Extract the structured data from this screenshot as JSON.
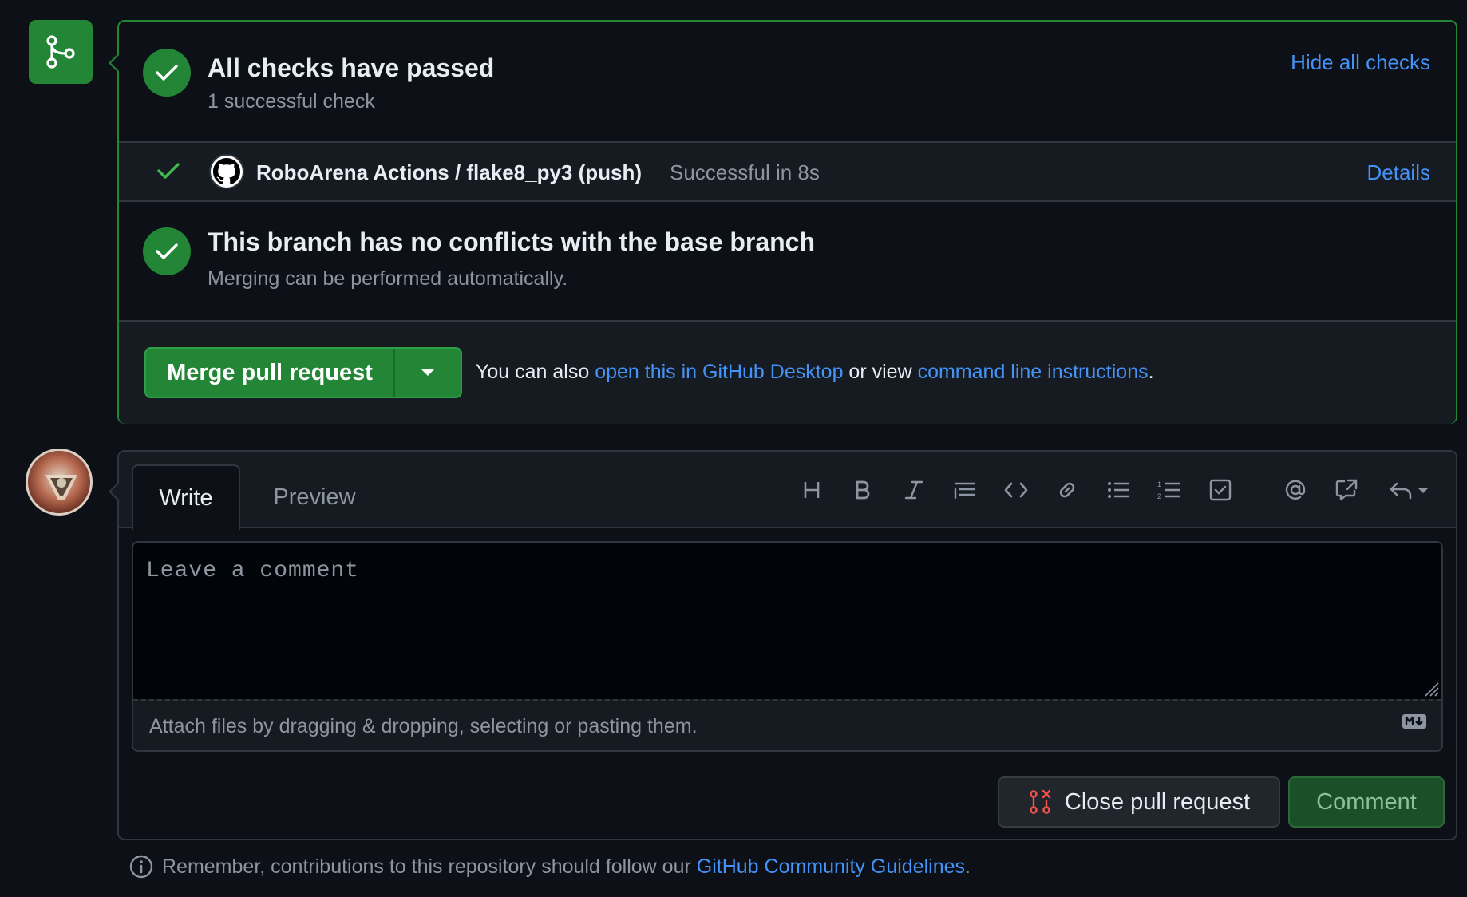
{
  "merge_box": {
    "checks_title": "All checks have passed",
    "checks_subtitle": "1 successful check",
    "hide_checks_label": "Hide all checks",
    "check_run": {
      "name": "RoboArena Actions / flake8_py3 (push)",
      "status": "Successful in 8s",
      "details_label": "Details"
    },
    "conflicts_title": "This branch has no conflicts with the base branch",
    "conflicts_subtitle": "Merging can be performed automatically.",
    "merge_button_label": "Merge pull request",
    "hint_prefix": "You can also ",
    "hint_link_desktop": "open this in GitHub Desktop",
    "hint_middle": " or view ",
    "hint_link_cli": "command line instructions",
    "hint_suffix": "."
  },
  "comment_box": {
    "tabs": [
      "Write",
      "Preview"
    ],
    "active_tab": "Write",
    "toolbar_icons": [
      "heading-icon",
      "bold-icon",
      "italic-icon",
      "quote-icon",
      "code-icon",
      "link-icon",
      "bulleted-list-icon",
      "numbered-list-icon",
      "task-list-icon",
      "mention-icon",
      "reference-icon",
      "saved-replies-icon"
    ],
    "placeholder": "Leave a comment",
    "value": "",
    "attach_text": "Attach files by dragging & dropping, selecting or pasting them.",
    "close_button_label": "Close pull request",
    "comment_button_label": "Comment"
  },
  "footer": {
    "prefix": "Remember, contributions to this repository should follow our ",
    "link": "GitHub Community Guidelines",
    "suffix": "."
  },
  "colors": {
    "success": "#238636",
    "link": "#4493f8",
    "danger": "#f85149",
    "background": "#0d1117"
  }
}
